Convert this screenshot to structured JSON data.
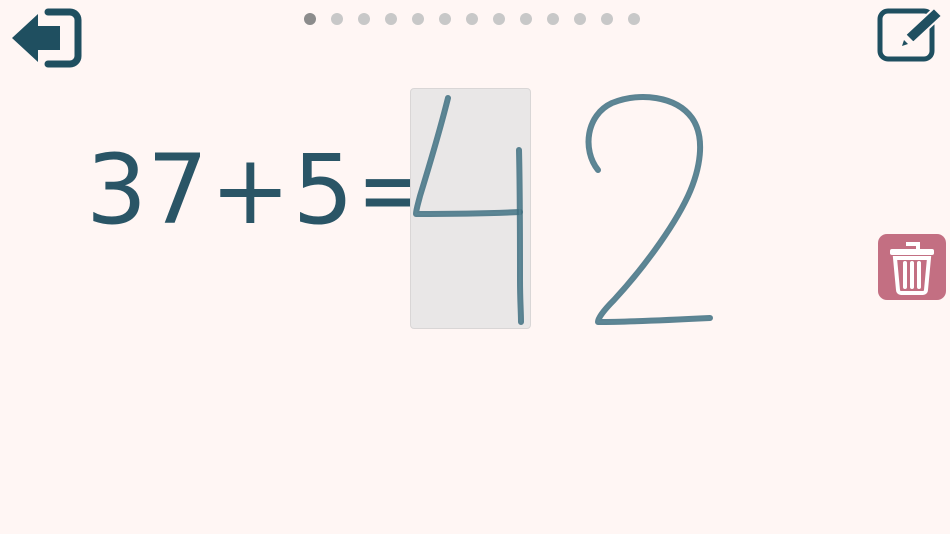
{
  "toolbar": {
    "back_icon": "exit-arrow-icon",
    "edit_icon": "pencil-square-icon"
  },
  "progress": {
    "total": 13,
    "current": 0
  },
  "equation": {
    "operand_a": "37",
    "operator": "+",
    "operand_b": "5",
    "equals": "=",
    "given_digit": "4"
  },
  "handwriting": {
    "strokes": [
      "4",
      "2"
    ],
    "stroke_color": "#3f6f80"
  },
  "actions": {
    "clear_icon": "trash-can-icon",
    "clear_color": "#c36f82"
  },
  "colors": {
    "primary": "#2a5566",
    "answer": "#e8202a",
    "background": "#fff6f4"
  }
}
